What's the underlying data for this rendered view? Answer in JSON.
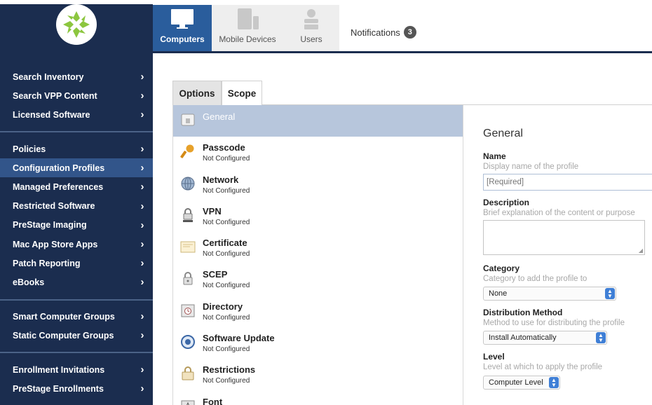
{
  "sidebar": {
    "logo": "jamf-logo-icon",
    "groups": [
      {
        "items": [
          {
            "label": "Search Inventory"
          },
          {
            "label": "Search VPP Content"
          },
          {
            "label": "Licensed Software"
          }
        ]
      },
      {
        "items": [
          {
            "label": "Policies"
          },
          {
            "label": "Configuration Profiles",
            "active": true
          },
          {
            "label": "Managed Preferences"
          },
          {
            "label": "Restricted Software"
          },
          {
            "label": "PreStage Imaging"
          },
          {
            "label": "Mac App Store Apps"
          },
          {
            "label": "Patch Reporting"
          },
          {
            "label": "eBooks"
          }
        ]
      },
      {
        "items": [
          {
            "label": "Smart Computer Groups"
          },
          {
            "label": "Static Computer Groups"
          }
        ]
      },
      {
        "items": [
          {
            "label": "Enrollment Invitations"
          },
          {
            "label": "PreStage Enrollments"
          }
        ]
      }
    ],
    "chevron": "›"
  },
  "topbar": {
    "tabs": [
      {
        "label": "Computers",
        "icon": "monitor-icon",
        "active": true
      },
      {
        "label": "Mobile Devices",
        "icon": "mobile-devices-icon"
      },
      {
        "label": "Users",
        "icon": "user-icon"
      }
    ],
    "notifications": {
      "label": "Notifications",
      "count": "3"
    }
  },
  "content_tabs": [
    "Options",
    "Scope"
  ],
  "payloads": [
    {
      "name": "General",
      "status": "",
      "icon": "general-icon",
      "selected": true
    },
    {
      "name": "Passcode",
      "status": "Not Configured",
      "icon": "key-icon"
    },
    {
      "name": "Network",
      "status": "Not Configured",
      "icon": "network-globe-icon"
    },
    {
      "name": "VPN",
      "status": "Not Configured",
      "icon": "vpn-lock-icon"
    },
    {
      "name": "Certificate",
      "status": "Not Configured",
      "icon": "certificate-icon"
    },
    {
      "name": "SCEP",
      "status": "Not Configured",
      "icon": "scep-lock-icon"
    },
    {
      "name": "Directory",
      "status": "Not Configured",
      "icon": "directory-icon"
    },
    {
      "name": "Software Update",
      "status": "Not Configured",
      "icon": "software-update-icon"
    },
    {
      "name": "Restrictions",
      "status": "Not Configured",
      "icon": "restrictions-icon"
    },
    {
      "name": "Font",
      "status": "",
      "icon": "font-icon"
    }
  ],
  "settings": {
    "heading": "General",
    "name": {
      "label": "Name",
      "hint": "Display name of the profile",
      "placeholder": "[Required]"
    },
    "description": {
      "label": "Description",
      "hint": "Brief explanation of the content or purpose"
    },
    "category": {
      "label": "Category",
      "hint": "Category to add the profile to",
      "value": "None"
    },
    "distribution": {
      "label": "Distribution Method",
      "hint": "Method to use for distributing the profile",
      "value": "Install Automatically"
    },
    "level": {
      "label": "Level",
      "hint": "Level at which to apply the profile",
      "value": "Computer Level"
    }
  },
  "colors": {
    "sidebar_bg": "#1b2d4f",
    "sidebar_active": "#32558a",
    "tab_active": "#2a5d9c",
    "selected_row": "#b7c6dc",
    "select_accent": "#3f7fd6"
  }
}
